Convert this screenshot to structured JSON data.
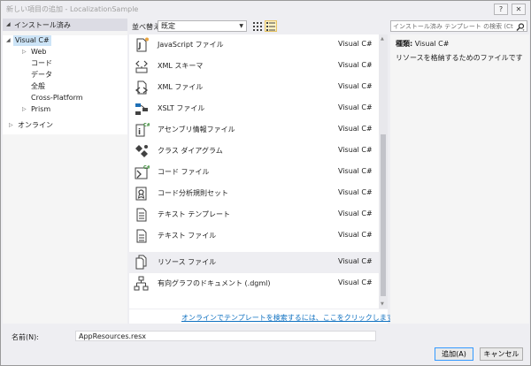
{
  "window": {
    "title": "新しい項目の追加 - LocalizationSample",
    "help_label": "?",
    "close_label": "✕"
  },
  "left_panel": {
    "header": "インストール済み",
    "tree": [
      {
        "label": "Visual C#",
        "expander": "◢",
        "selected": true
      },
      {
        "label": "Web",
        "expander": "▷"
      },
      {
        "label": "コード",
        "expander": ""
      },
      {
        "label": "データ",
        "expander": ""
      },
      {
        "label": "全般",
        "expander": ""
      },
      {
        "label": "Cross-Platform",
        "expander": ""
      },
      {
        "label": "Prism",
        "expander": "▷"
      }
    ],
    "online": {
      "label": "オンライン",
      "expander": "▷"
    }
  },
  "sort": {
    "label": "並べ替え:",
    "selected": "既定"
  },
  "search": {
    "placeholder": "インストール済み テンプレート の検索 (Ctrl+E"
  },
  "templates": [
    {
      "name": "JavaScript ファイル",
      "lang": "Visual C#",
      "icon": "javascript-file-icon"
    },
    {
      "name": "XML スキーマ",
      "lang": "Visual C#",
      "icon": "xml-schema-icon"
    },
    {
      "name": "XML ファイル",
      "lang": "Visual C#",
      "icon": "xml-file-icon"
    },
    {
      "name": "XSLT ファイル",
      "lang": "Visual C#",
      "icon": "xslt-file-icon"
    },
    {
      "name": "アセンブリ情報ファイル",
      "lang": "Visual C#",
      "icon": "assembly-info-icon"
    },
    {
      "name": "クラス ダイアグラム",
      "lang": "Visual C#",
      "icon": "class-diagram-icon"
    },
    {
      "name": "コード ファイル",
      "lang": "Visual C#",
      "icon": "code-file-icon"
    },
    {
      "name": "コード分析規則セット",
      "lang": "Visual C#",
      "icon": "ruleset-icon"
    },
    {
      "name": "テキスト テンプレート",
      "lang": "Visual C#",
      "icon": "text-template-icon"
    },
    {
      "name": "テキスト ファイル",
      "lang": "Visual C#",
      "icon": "text-file-icon"
    },
    {
      "name": "リソース ファイル",
      "lang": "Visual C#",
      "icon": "resource-file-icon",
      "selected": true
    },
    {
      "name": "有向グラフのドキュメント (.dgml)",
      "lang": "Visual C#",
      "icon": "directed-graph-icon"
    }
  ],
  "online_link": "オンラインでテンプレートを検索するには、ここをクリックします。",
  "details": {
    "type_key": "種類:",
    "type_value": "Visual C#",
    "description": "リソースを格納するためのファイルです"
  },
  "name_field": {
    "label": "名前(N):",
    "value": "AppResources.resx"
  },
  "buttons": {
    "add": "追加(A)",
    "cancel": "キャンセル"
  },
  "colors": {
    "selection": "#cce4f7",
    "link": "#0e70c0",
    "accent_cs": "#68217a"
  }
}
